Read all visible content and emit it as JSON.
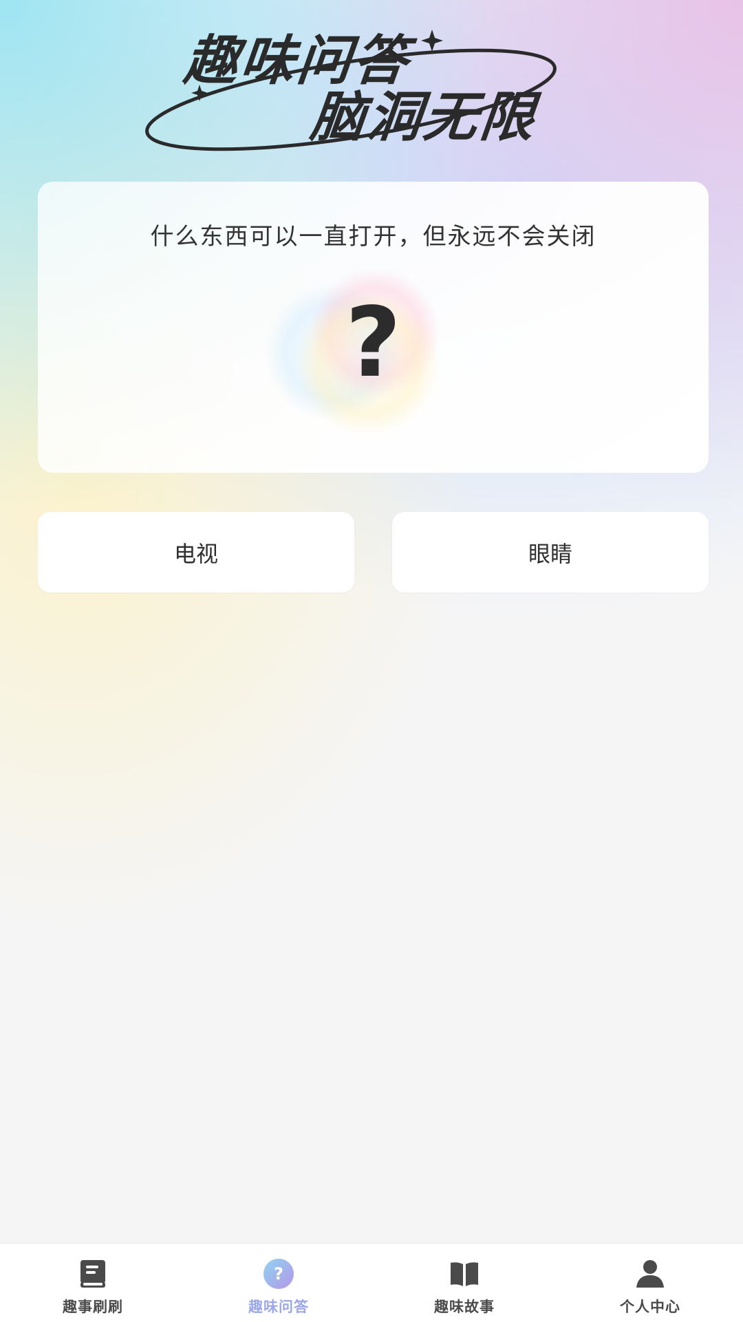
{
  "header": {
    "title_line1": "趣味问答",
    "title_line2": "脑洞无限"
  },
  "question": {
    "text": "什么东西可以一直打开，但永远不会关闭",
    "placeholder_icon": "question-mark-icon",
    "placeholder_glyph": "?"
  },
  "options": [
    {
      "label": "电视"
    },
    {
      "label": "眼睛"
    }
  ],
  "tabbar": {
    "active_index": 1,
    "active_color": "#9aa8ea",
    "items": [
      {
        "label": "趣事刷刷",
        "icon": "book-list-icon"
      },
      {
        "label": "趣味问答",
        "icon": "question-circle-icon"
      },
      {
        "label": "趣味故事",
        "icon": "open-book-icon"
      },
      {
        "label": "个人中心",
        "icon": "user-icon"
      }
    ]
  }
}
